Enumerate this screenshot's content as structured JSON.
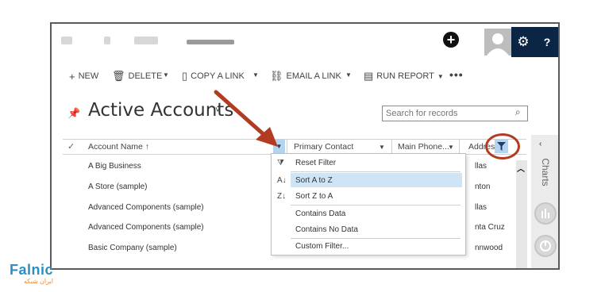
{
  "toolbar": {
    "new_label": "NEW",
    "delete_label": "DELETE",
    "copy_link_label": "COPY A LINK",
    "email_link_label": "EMAIL A LINK",
    "run_report_label": "RUN REPORT",
    "more_label": "•••"
  },
  "header": {
    "title": "Active Accounts",
    "search_placeholder": "Search for records"
  },
  "grid": {
    "columns": [
      "Account Name ↑",
      "Primary Contact",
      "Main Phone...",
      "Address"
    ],
    "rows": [
      {
        "name": "A Big Business",
        "address": "llas"
      },
      {
        "name": "A Store (sample)",
        "address": "nton"
      },
      {
        "name": "Advanced Components (sample)",
        "address": "llas"
      },
      {
        "name": "Advanced Components (sample)",
        "address": "nta Cruz"
      },
      {
        "name": "Basic Company (sample)",
        "address": "nnwood"
      }
    ]
  },
  "filter_menu": {
    "items": [
      {
        "label": "Reset Filter",
        "icon": "reset-filter-icon"
      },
      {
        "label": "Sort A to Z",
        "icon": "sort-az-icon"
      },
      {
        "label": "Sort Z to A",
        "icon": "sort-za-icon"
      },
      {
        "label": "Contains Data",
        "icon": ""
      },
      {
        "label": "Contains No Data",
        "icon": ""
      },
      {
        "label": "Custom Filter...",
        "icon": ""
      }
    ],
    "highlighted": "Sort A to Z"
  },
  "charts_pane": {
    "label": "Charts"
  },
  "logo": {
    "part1": "Fa",
    "part2": "lnic",
    "sub": "ایران شبکه"
  },
  "colors": {
    "accent_dark": "#0b2545",
    "highlight": "#cfe4f5",
    "annotation_red": "#b23b22"
  }
}
